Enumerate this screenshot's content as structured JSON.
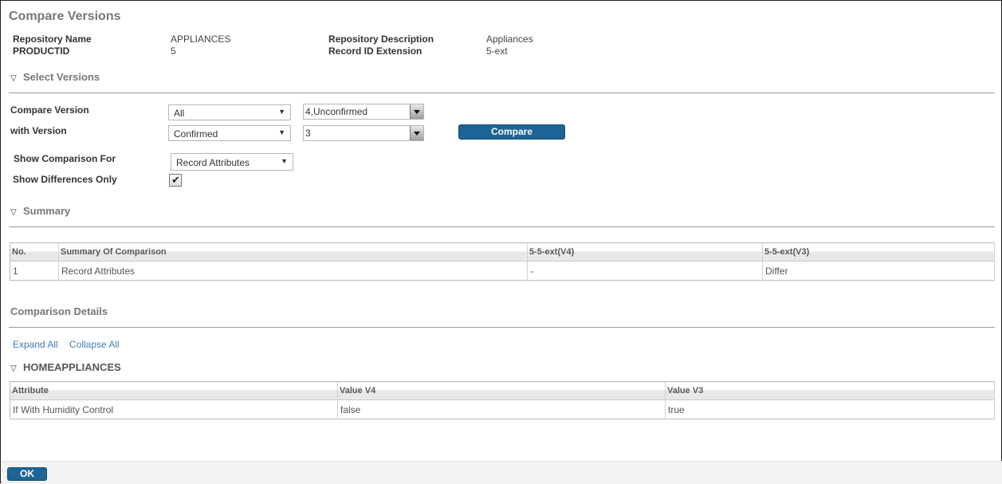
{
  "header": {
    "title": "Compare Versions"
  },
  "info": {
    "repo_name_label": "Repository Name",
    "repo_name_value": "APPLIANCES",
    "productid_label": "PRODUCTID",
    "productid_value": "5",
    "repo_desc_label": "Repository Description",
    "repo_desc_value": "Appliances",
    "record_ext_label": "Record ID Extension",
    "record_ext_value": "5-ext"
  },
  "select_versions": {
    "heading": "Select Versions",
    "compare_version_label": "Compare Version",
    "with_version_label": "with Version",
    "compare_filter": "All",
    "compare_version": "4,Unconfirmed",
    "with_filter": "Confirmed",
    "with_version": "3",
    "compare_button": "Compare",
    "show_comparison_label": "Show Comparison For",
    "show_comparison_value": "Record Attributes",
    "show_diff_label": "Show Differences Only",
    "show_diff_checked": true
  },
  "summary": {
    "heading": "Summary",
    "columns": [
      "No.",
      "Summary Of Comparison",
      "5-5-ext(V4)",
      "5-5-ext(V3)"
    ],
    "rows": [
      [
        "1",
        "Record Attributes",
        "-",
        "Differ"
      ]
    ]
  },
  "details": {
    "heading": "Comparison Details",
    "expand_all": "Expand All",
    "collapse_all": "Collapse All",
    "group_heading": "HOMEAPPLIANCES",
    "columns": [
      "Attribute",
      "Value V4",
      "Value V3"
    ],
    "rows": [
      [
        "If With Humidity Control",
        "false",
        "true"
      ]
    ]
  },
  "footer": {
    "ok_button": "OK"
  },
  "colors": {
    "primary": "#1d6596",
    "link": "#3f7fb5",
    "heading": "#777777"
  }
}
